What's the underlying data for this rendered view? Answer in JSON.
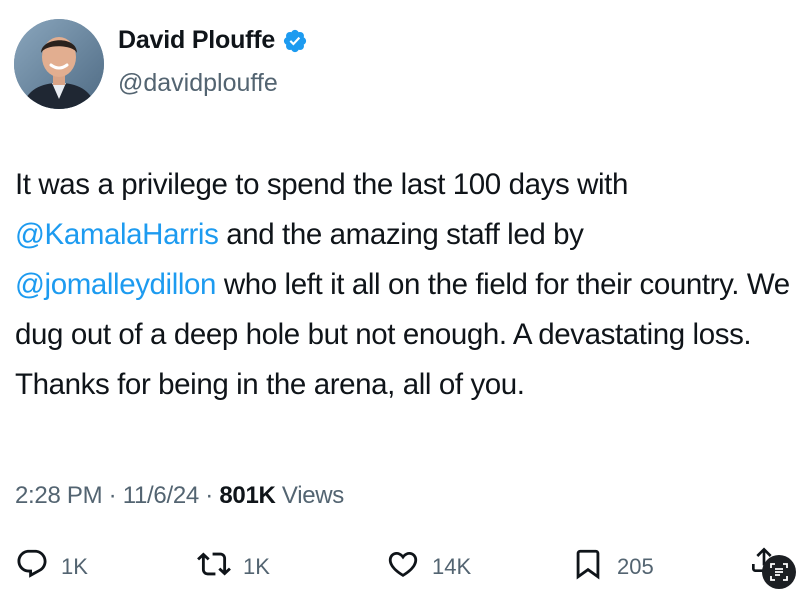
{
  "profile": {
    "display_name": "David Plouffe",
    "handle": "@davidplouffe",
    "verified": true,
    "avatar_icon": "user-avatar-photo",
    "verified_icon": "verified-badge-icon",
    "verified_color": "#1d9bf0"
  },
  "tweet": {
    "segments": [
      {
        "text": "It was a privilege to spend the last 100 days with ",
        "mention": false
      },
      {
        "text": "@KamalaHarris",
        "mention": true
      },
      {
        "text": " and the amazing staff led by ",
        "mention": false
      },
      {
        "text": "@jomalleydillon",
        "mention": true
      },
      {
        "text": " who left it all on the field for their country. We dug out of a deep hole but not enough. A devastating loss. Thanks for being in the arena, all of you.",
        "mention": false
      }
    ]
  },
  "meta": {
    "time": "2:28 PM",
    "date": "11/6/24",
    "separator": " · ",
    "views_count": "801K",
    "views_label": " Views"
  },
  "actions": {
    "reply": {
      "icon": "reply-icon",
      "count": "1K"
    },
    "retweet": {
      "icon": "retweet-icon",
      "count": "1K"
    },
    "like": {
      "icon": "heart-icon",
      "count": "14K"
    },
    "bookmark": {
      "icon": "bookmark-icon",
      "count": "205"
    },
    "share": {
      "icon": "share-icon"
    }
  },
  "colors": {
    "text": "#0f1419",
    "secondary": "#536471",
    "link": "#1d9bf0",
    "background": "#ffffff"
  }
}
